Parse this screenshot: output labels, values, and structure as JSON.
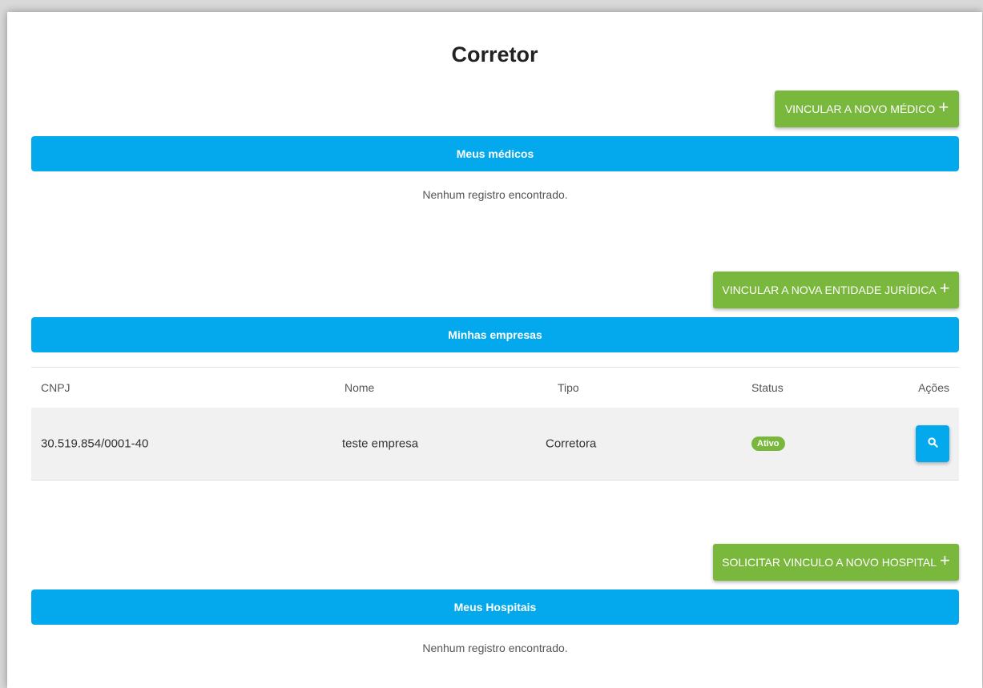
{
  "page": {
    "title": "Corretor"
  },
  "medicos": {
    "button_label": "VINCULAR A NOVO MÉDICO",
    "button_icon": "plus-icon",
    "section_title": "Meus médicos",
    "empty_message": "Nenhum registro encontrado."
  },
  "empresas": {
    "button_label": "VINCULAR A NOVA ENTIDADE JURÍDICA",
    "button_icon": "plus-icon",
    "section_title": "Minhas empresas",
    "columns": [
      "CNPJ",
      "Nome",
      "Tipo",
      "Status",
      "Ações"
    ],
    "rows": [
      {
        "cnpj": "30.519.854/0001-40",
        "nome": "teste empresa",
        "tipo": "Corretora",
        "status": "Ativo",
        "action_icon": "search-icon"
      }
    ]
  },
  "hospitais": {
    "button_label": "SOLICITAR VINCULO A NOVO HOSPITAL",
    "button_icon": "plus-icon",
    "section_title": "Meus Hospitais",
    "empty_message": "Nenhum registro encontrado."
  },
  "colors": {
    "green_button": "#79b83d",
    "blue_bar": "#03a9ec",
    "status_active": "#79b83d"
  }
}
